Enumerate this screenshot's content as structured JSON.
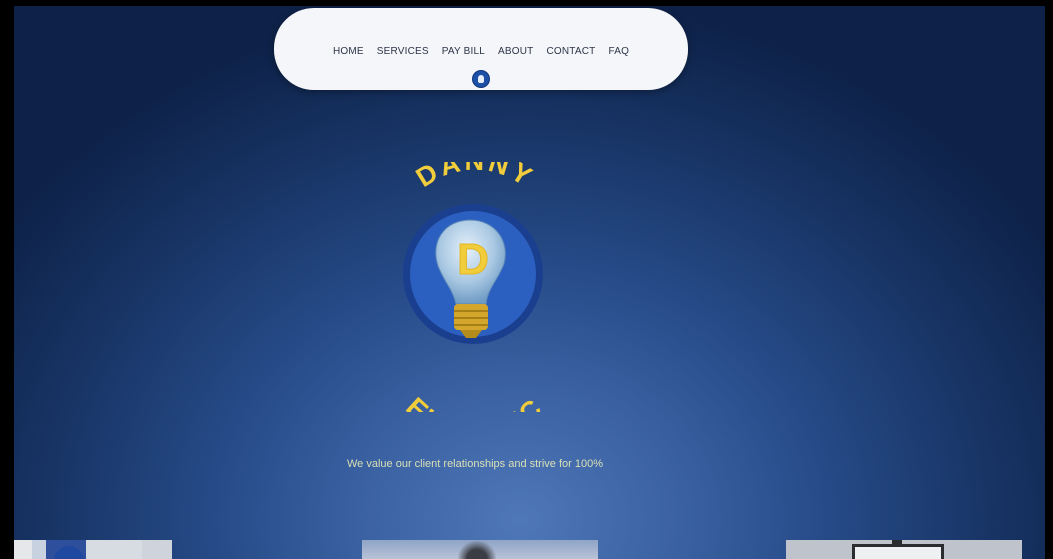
{
  "nav": {
    "links": [
      "HOME",
      "SERVICES",
      "PAY BILL",
      "ABOUT",
      "CONTACT",
      "FAQ"
    ]
  },
  "logo": {
    "top_text": "DANNY",
    "bottom_text": "ELECTRIC",
    "center_letter": "D"
  },
  "hero": {
    "tagline": "We value our client relationships and strive for 100%"
  },
  "colors": {
    "accent_yellow": "#f2cd3b",
    "logo_blue": "#1f4fa8",
    "nav_background": "#f4f6f9"
  },
  "icons": {
    "nav_badge": "lightbulb-icon"
  }
}
